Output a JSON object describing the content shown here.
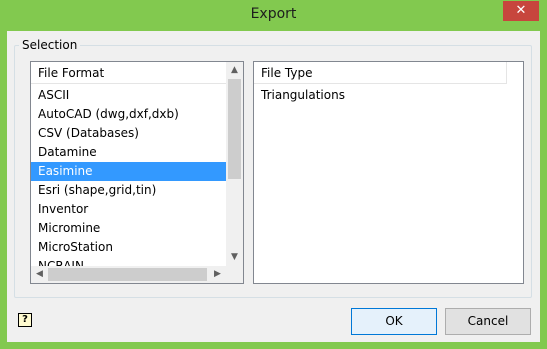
{
  "window": {
    "title": "Export",
    "close_glyph": "✕"
  },
  "group": {
    "label": "Selection"
  },
  "left_list": {
    "header": "File Format",
    "items": [
      "ASCII",
      "AutoCAD (dwg,dxf,dxb)",
      "CSV (Databases)",
      "Datamine",
      "Easimine",
      "Esri (shape,grid,tin)",
      "Inventor",
      "Micromine",
      "MicroStation",
      "NCRAIN"
    ],
    "selected": "Easimine",
    "scroll_up": "▲",
    "scroll_down": "▼",
    "scroll_left": "◀",
    "scroll_right": "▶"
  },
  "right_list": {
    "header": "File Type",
    "items": [
      "Triangulations"
    ]
  },
  "buttons": {
    "ok": "OK",
    "cancel": "Cancel"
  },
  "help": {
    "glyph": "?"
  }
}
